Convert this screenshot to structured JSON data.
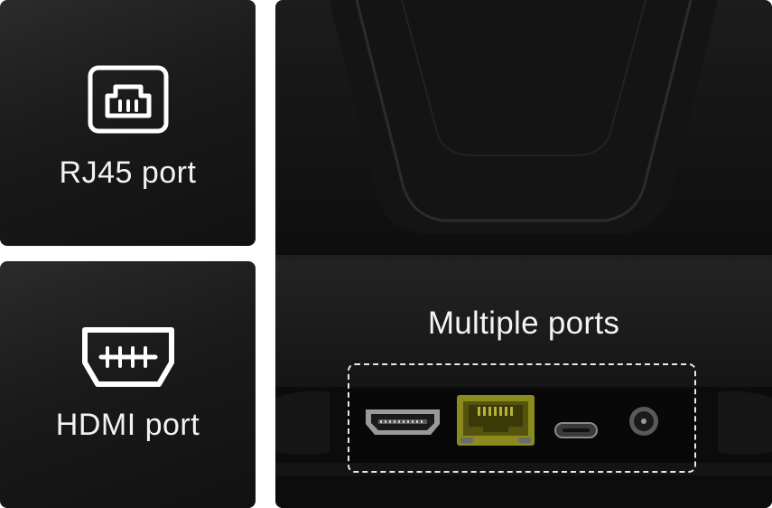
{
  "cards": {
    "rj45": {
      "label": "RJ45 port",
      "icon": "rj45-port-icon"
    },
    "hdmi": {
      "label": "HDMI port",
      "icon": "hdmi-port-icon"
    }
  },
  "main": {
    "title": "Multiple ports",
    "ports": [
      {
        "name": "hdmi-port",
        "icon": "hdmi-connector-icon"
      },
      {
        "name": "rj45-port",
        "icon": "ethernet-jack-icon"
      },
      {
        "name": "usb-c-port",
        "icon": "usb-c-icon"
      },
      {
        "name": "dc-power-port",
        "icon": "dc-jack-icon"
      }
    ]
  },
  "colors": {
    "card_background": "#1a1a1a",
    "text": "#f2f2f2",
    "rj45_jack": "#8b8a1e",
    "dashed_frame": "#e8e8e8"
  }
}
